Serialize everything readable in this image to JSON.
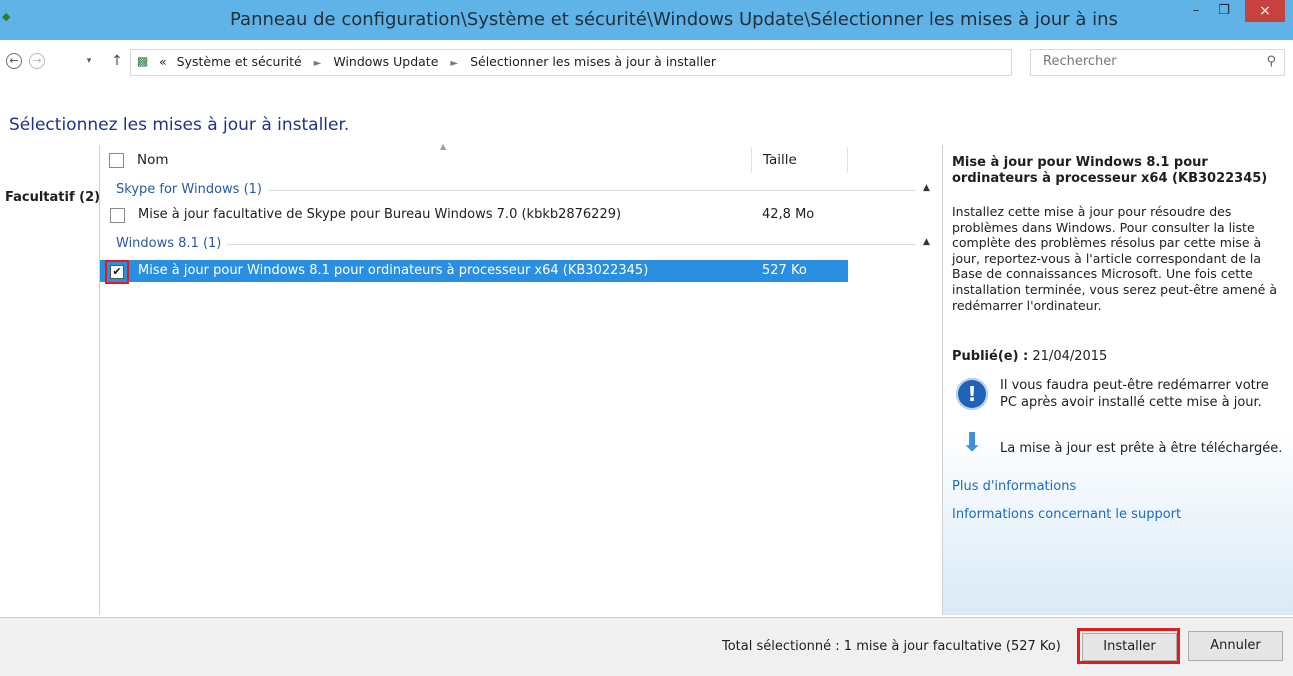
{
  "window": {
    "title": "Panneau de configuration\\Système et sécurité\\Windows Update\\Sélectionner les mises à jour à ins",
    "close_glyph": "×",
    "minimize_glyph": "–",
    "maximize_glyph": "❐"
  },
  "address": {
    "recent_glyph": "▾",
    "overflow": "«",
    "crumbs": [
      "Système et sécurité",
      "Windows Update",
      "Sélectionner les mises à jour à installer"
    ],
    "search_placeholder": "Rechercher"
  },
  "page": {
    "heading": "Sélectionnez les mises à jour à installer."
  },
  "categories": [
    {
      "label": "Facultatif (2)"
    }
  ],
  "columns": {
    "name": "Nom",
    "size": "Taille"
  },
  "groups": [
    {
      "label": "Skype for Windows (1)",
      "items": [
        {
          "name": "Mise à jour facultative de Skype pour Bureau Windows 7.0 (kbkb2876229)",
          "size": "42,8 Mo",
          "checked": false
        }
      ]
    },
    {
      "label": "Windows 8.1 (1)",
      "items": [
        {
          "name": "Mise à jour pour Windows 8.1 pour ordinateurs à processeur x64 (KB3022345)",
          "size": "527 Ko",
          "checked": true
        }
      ]
    }
  ],
  "details": {
    "title": "Mise à jour pour Windows 8.1 pour ordinateurs à processeur x64 (KB3022345)",
    "description": "Installez cette mise à jour pour résoudre des problèmes dans Windows. Pour consulter la liste complète des problèmes résolus par cette mise à jour, reportez-vous à l'article correspondant de la Base de connaissances Microsoft. Une fois cette installation terminée, vous serez peut-être amené à redémarrer l'ordinateur.",
    "published_label": "Publié(e) :",
    "published_date": "21/04/2015",
    "restart_note": "Il vous faudra peut-être redémarrer votre PC après avoir installé cette mise à jour.",
    "ready_note": "La mise à jour est prête à être téléchargée.",
    "link_more": "Plus d'informations",
    "link_support": "Informations concernant le support"
  },
  "footer": {
    "total": "Total sélectionné : 1 mise à jour facultative (527 Ko)",
    "install_label": "Installer",
    "cancel_label": "Annuler"
  },
  "colors": {
    "titlebar": "#5fb3e6",
    "selection": "#2a8fe0",
    "highlight_box": "#e21b1b",
    "link": "#1d6bbf",
    "group_label": "#2759a6"
  }
}
